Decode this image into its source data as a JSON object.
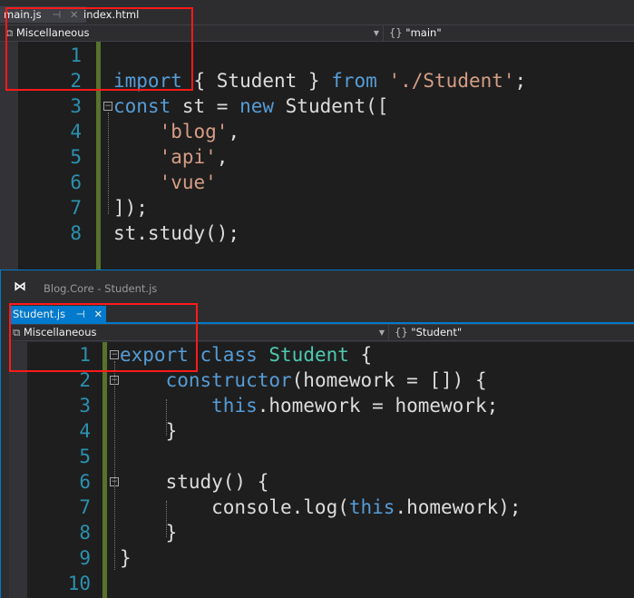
{
  "top": {
    "tabs": [
      {
        "label": "main.js",
        "active": true
      },
      {
        "label": "index.html",
        "active": false
      }
    ],
    "nav_project": "Miscellaneous",
    "nav_scope": "\"main\"",
    "lines": [
      [],
      [
        [
          "k",
          "import"
        ],
        [
          "t",
          " { Student } "
        ],
        [
          "k",
          "from"
        ],
        [
          "t",
          " "
        ],
        [
          "s",
          "'./Student'"
        ],
        [
          "t",
          ";"
        ]
      ],
      [
        [
          "k",
          "const"
        ],
        [
          "t",
          " st = "
        ],
        [
          "k",
          "new"
        ],
        [
          "t",
          " Student(["
        ]
      ],
      [
        [
          "t",
          "    "
        ],
        [
          "s",
          "'blog'"
        ],
        [
          "t",
          ","
        ]
      ],
      [
        [
          "t",
          "    "
        ],
        [
          "s",
          "'api'"
        ],
        [
          "t",
          ","
        ]
      ],
      [
        [
          "t",
          "    "
        ],
        [
          "s",
          "'vue'"
        ]
      ],
      [
        [
          "t",
          "]);"
        ]
      ],
      [
        [
          "t",
          "st.study();"
        ]
      ]
    ],
    "line_numbers": [
      "1",
      "2",
      "3",
      "4",
      "5",
      "6",
      "7",
      "8"
    ]
  },
  "bottom": {
    "window_title": "Blog.Core - Student.js",
    "tabs": [
      {
        "label": "Student.js",
        "active": true
      }
    ],
    "nav_project": "Miscellaneous",
    "nav_scope": "\"Student\"",
    "lines": [
      [
        [
          "k",
          "export"
        ],
        [
          "t",
          " "
        ],
        [
          "k",
          "class"
        ],
        [
          "t",
          " "
        ],
        [
          "c",
          "Student"
        ],
        [
          "t",
          " {"
        ]
      ],
      [
        [
          "t",
          "    "
        ],
        [
          "k",
          "constructor"
        ],
        [
          "t",
          "(homework = []) {"
        ]
      ],
      [
        [
          "t",
          "        "
        ],
        [
          "k",
          "this"
        ],
        [
          "t",
          ".homework = homework;"
        ]
      ],
      [
        [
          "t",
          "    }"
        ]
      ],
      [],
      [
        [
          "t",
          "    study() {"
        ]
      ],
      [
        [
          "t",
          "        console.log("
        ],
        [
          "k",
          "this"
        ],
        [
          "t",
          ".homework);"
        ]
      ],
      [
        [
          "t",
          "    }"
        ]
      ],
      [
        [
          "t",
          "}"
        ]
      ],
      []
    ],
    "line_numbers": [
      "1",
      "2",
      "3",
      "4",
      "5",
      "6",
      "7",
      "8",
      "9",
      "10"
    ]
  },
  "colors": {
    "accent": "#007acc",
    "keyword": "#569cd6",
    "string": "#d69d85",
    "type": "#4ec9b0",
    "highlight": "#ff1a1a"
  }
}
